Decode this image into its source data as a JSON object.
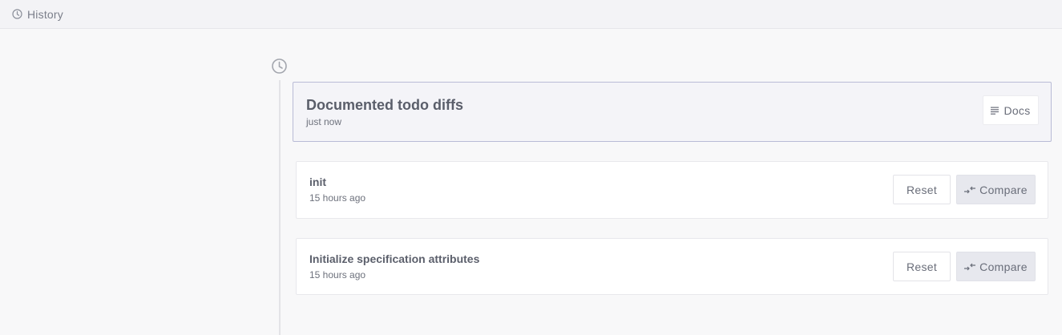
{
  "header": {
    "title": "History",
    "icon": "clock-icon"
  },
  "timeline": {
    "icon": "clock-icon"
  },
  "current_version": {
    "message": "Documented todo diffs",
    "time": "just now",
    "docs_label": "Docs",
    "docs_icon": "lines-icon"
  },
  "versions": [
    {
      "message": "init",
      "time": "15 hours ago",
      "reset_label": "Reset",
      "compare_label": "Compare"
    },
    {
      "message": "Initialize specification attributes",
      "time": "15 hours ago",
      "reset_label": "Reset",
      "compare_label": "Compare"
    }
  ],
  "colors": {
    "background": "#f8f8f9",
    "current_card_border": "#b9bbd6",
    "compare_button": "#e7e8ee"
  }
}
